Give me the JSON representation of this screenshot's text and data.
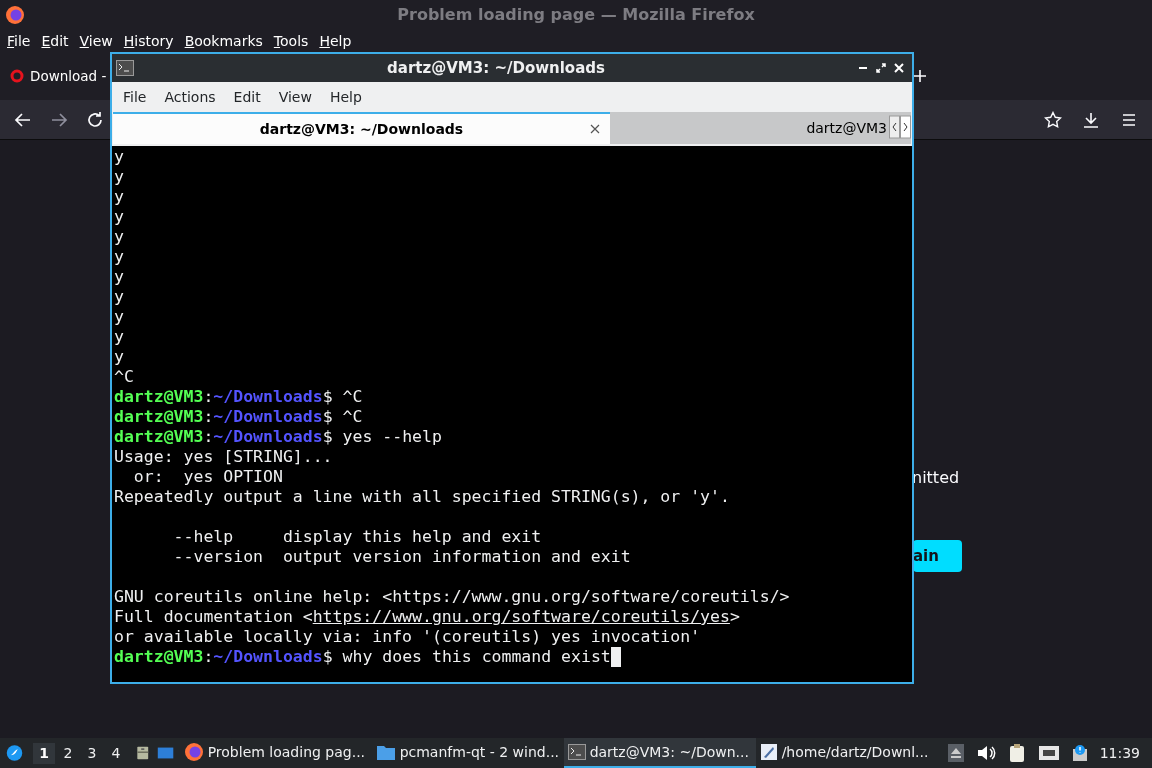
{
  "firefox": {
    "title": "Problem loading page — Mozilla Firefox",
    "menu": [
      "File",
      "Edit",
      "View",
      "History",
      "Bookmarks",
      "Tools",
      "Help"
    ],
    "tab": {
      "label": "Download -"
    },
    "page_text": "nitted",
    "page_button": "ain"
  },
  "terminal": {
    "title": "dartz@VM3: ~/Downloads",
    "menu": [
      "File",
      "Actions",
      "Edit",
      "View",
      "Help"
    ],
    "tabs": [
      {
        "label": "dartz@VM3: ~/Downloads",
        "selected": true
      },
      {
        "label": "dartz@VM3",
        "selected": false
      }
    ],
    "lines": [
      {
        "kind": "output",
        "text": "y"
      },
      {
        "kind": "output",
        "text": "y"
      },
      {
        "kind": "output",
        "text": "y"
      },
      {
        "kind": "output",
        "text": "y"
      },
      {
        "kind": "output",
        "text": "y"
      },
      {
        "kind": "output",
        "text": "y"
      },
      {
        "kind": "output",
        "text": "y"
      },
      {
        "kind": "output",
        "text": "y"
      },
      {
        "kind": "output",
        "text": "y"
      },
      {
        "kind": "output",
        "text": "y"
      },
      {
        "kind": "output",
        "text": "y"
      },
      {
        "kind": "output",
        "text": "^C"
      },
      {
        "kind": "prompt",
        "user": "dartz@VM3",
        "separator": ":",
        "path": "~/Downloads",
        "sign": "$",
        "command": "^C"
      },
      {
        "kind": "prompt",
        "user": "dartz@VM3",
        "separator": ":",
        "path": "~/Downloads",
        "sign": "$",
        "command": "^C"
      },
      {
        "kind": "prompt",
        "user": "dartz@VM3",
        "separator": ":",
        "path": "~/Downloads",
        "sign": "$",
        "command": "yes --help"
      },
      {
        "kind": "output",
        "text": "Usage: yes [STRING]..."
      },
      {
        "kind": "output",
        "text": "  or:  yes OPTION"
      },
      {
        "kind": "output",
        "text": "Repeatedly output a line with all specified STRING(s), or 'y'."
      },
      {
        "kind": "blank"
      },
      {
        "kind": "output",
        "text": "      --help     display this help and exit"
      },
      {
        "kind": "output",
        "text": "      --version  output version information and exit"
      },
      {
        "kind": "blank"
      },
      {
        "kind": "output",
        "text": "GNU coreutils online help: <https://www.gnu.org/software/coreutils/>"
      },
      {
        "kind": "link",
        "before": "Full documentation <",
        "link": "https://www.gnu.org/software/coreutils/yes",
        "after": ">"
      },
      {
        "kind": "output",
        "text": "or available locally via: info '(coreutils) yes invocation'"
      },
      {
        "kind": "prompt",
        "user": "dartz@VM3",
        "separator": ":",
        "path": "~/Downloads",
        "sign": "$",
        "command": "why does this command exist",
        "cursor": true
      }
    ]
  },
  "taskbar": {
    "workspaces": [
      {
        "label": "1",
        "selected": true
      },
      {
        "label": "2",
        "selected": false
      },
      {
        "label": "3",
        "selected": false
      },
      {
        "label": "4",
        "selected": false
      }
    ],
    "tasks": [
      {
        "kind": "browser",
        "label": "Problem loading pag...",
        "selected": false
      },
      {
        "kind": "folder",
        "label": "pcmanfm-qt - 2 wind...",
        "selected": false
      },
      {
        "kind": "terminal",
        "label": "dartz@VM3: ~/Down...",
        "selected": true
      },
      {
        "kind": "editor",
        "label": "/home/dartz/Downl...",
        "selected": false
      }
    ],
    "clock": "11:39"
  }
}
